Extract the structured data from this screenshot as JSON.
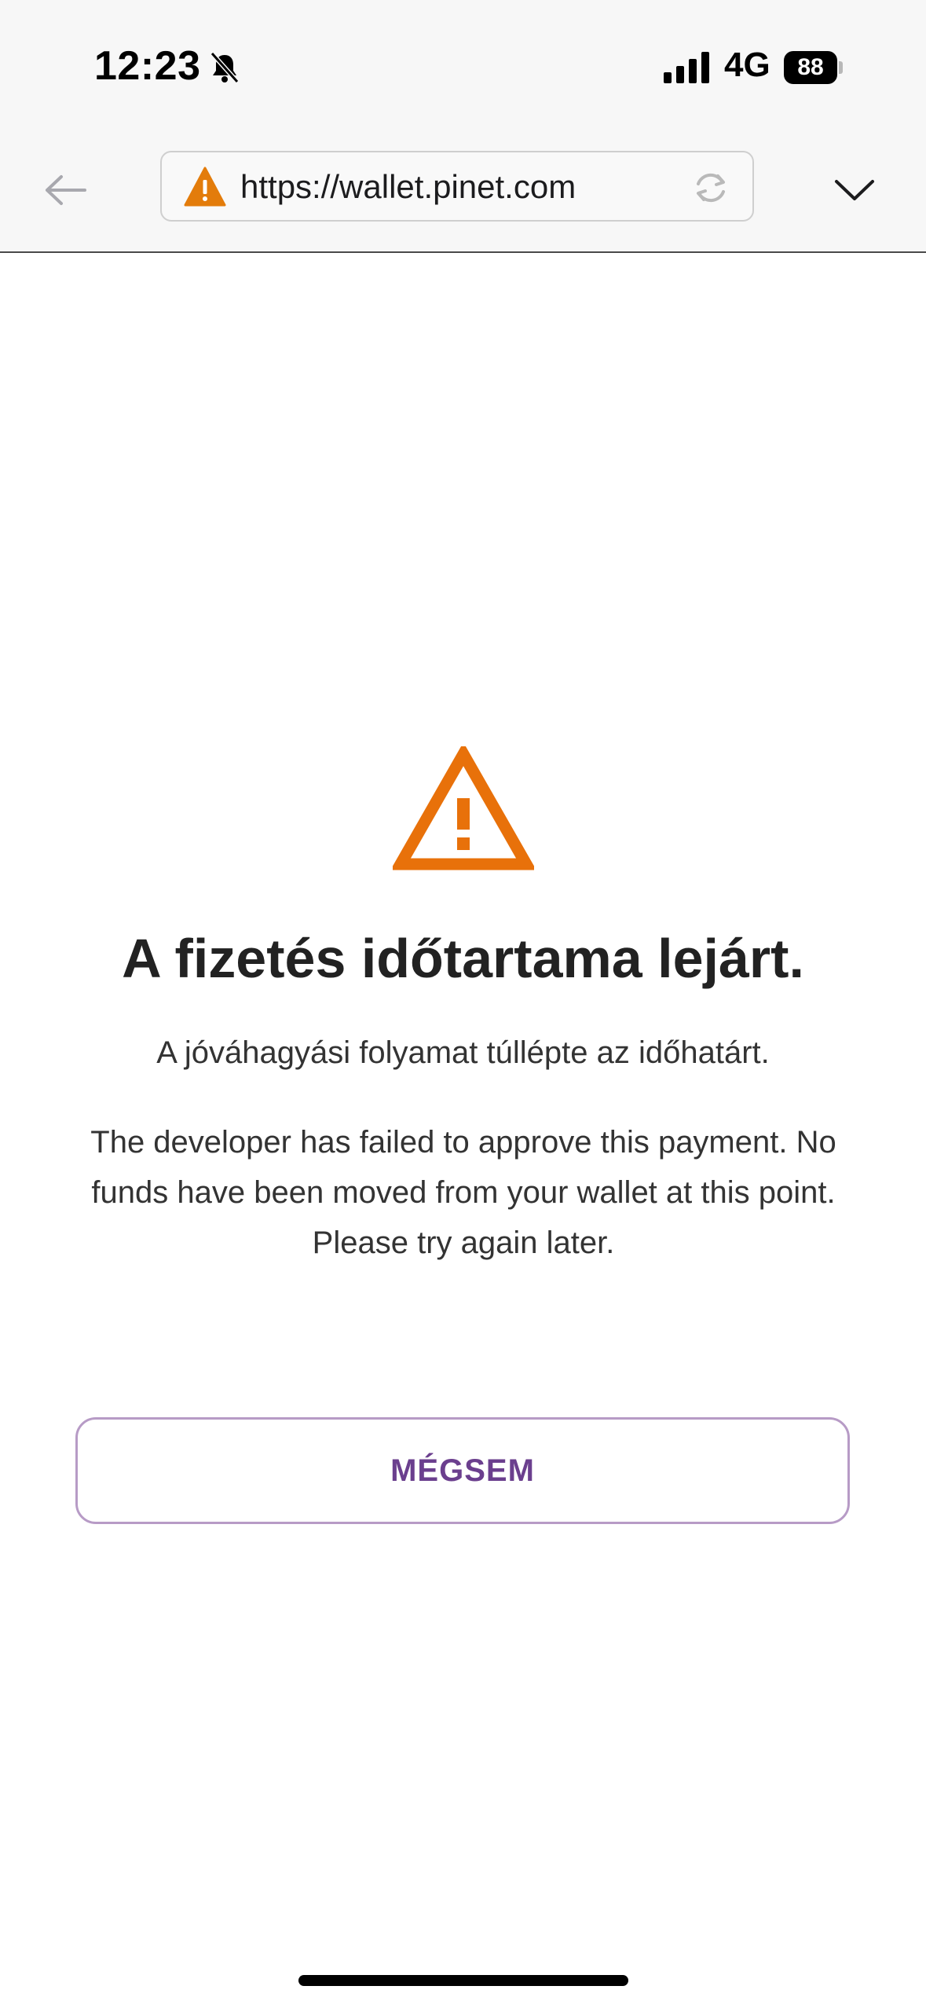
{
  "status_bar": {
    "time": "12:23",
    "network": "4G",
    "battery": "88",
    "icons": [
      "bell-slash-icon",
      "signal-icon",
      "battery-icon"
    ]
  },
  "browser": {
    "url": "https://wallet.pinet.com",
    "icons": [
      "back-arrow-icon",
      "warning-icon",
      "reload-icon",
      "chevron-down-icon"
    ]
  },
  "main": {
    "title": "A fizetés időtartama lejárt.",
    "subtitle": "A jóváhagyási folyamat túllépte az időhatárt.",
    "message": "The developer has failed to approve this payment. No funds have been moved from your wallet at this point. Please try again later.",
    "cancel_label": "MÉGSEM"
  },
  "colors": {
    "warning": "#E8710A",
    "url_warning": "#E37C0B",
    "button_text": "#6B3F8E",
    "button_border": "#B79BC6"
  }
}
